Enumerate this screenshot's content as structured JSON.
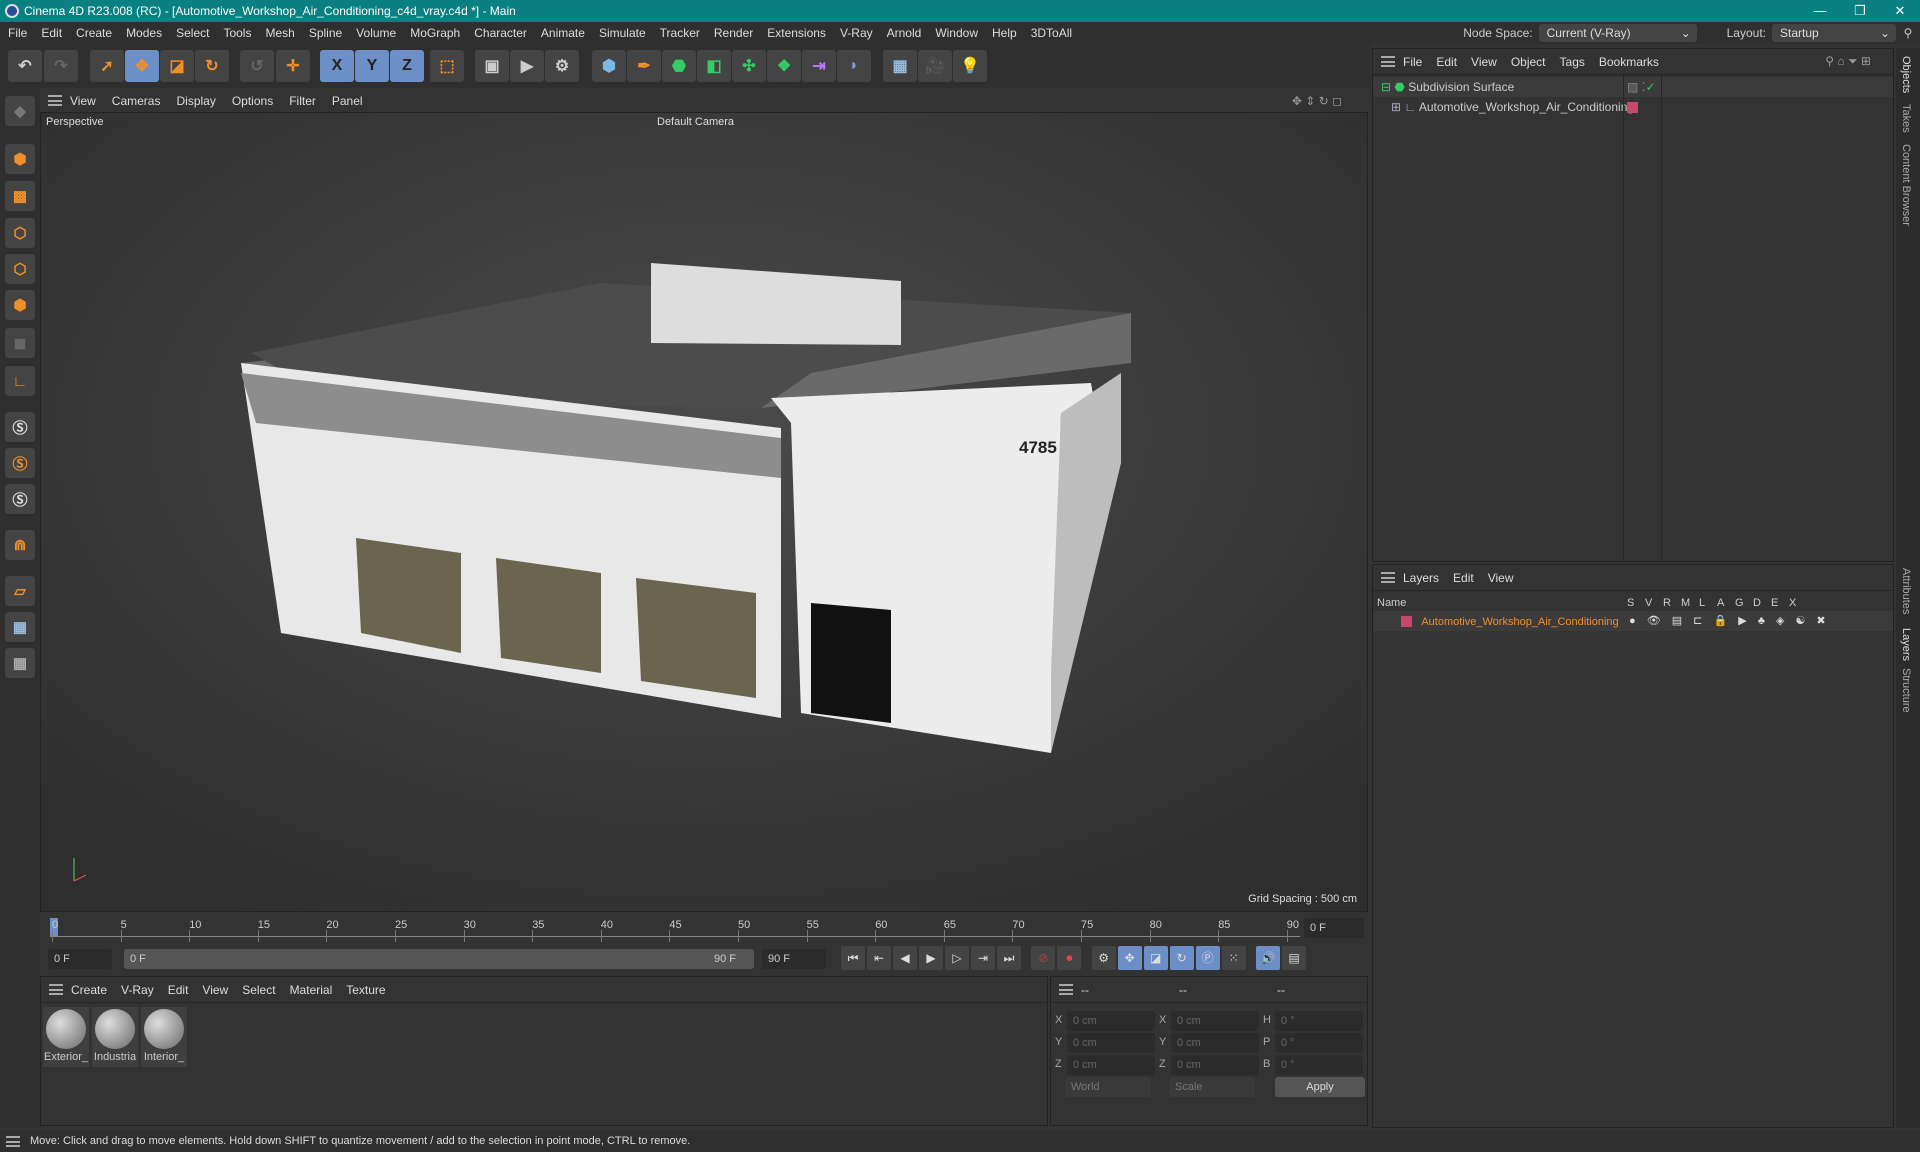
{
  "window": {
    "title": "Cinema 4D R23.008 (RC) - [Automotive_Workshop_Air_Conditioning_c4d_vray.c4d *] - Main",
    "minimize": "—",
    "restore": "❐",
    "close": "✕"
  },
  "menu": [
    "File",
    "Edit",
    "Create",
    "Modes",
    "Select",
    "Tools",
    "Mesh",
    "Spline",
    "Volume",
    "MoGraph",
    "Character",
    "Animate",
    "Simulate",
    "Tracker",
    "Render",
    "Extensions",
    "V-Ray",
    "Arnold",
    "Window",
    "Help",
    "3DToAll"
  ],
  "header": {
    "node_space_label": "Node Space:",
    "node_space_value": "Current (V-Ray)",
    "layout_label": "Layout:",
    "layout_value": "Startup"
  },
  "toolbar": {
    "x": "X",
    "y": "Y",
    "z": "Z"
  },
  "viewport": {
    "menu": [
      "View",
      "Cameras",
      "Display",
      "Options",
      "Filter",
      "Panel"
    ],
    "projection": "Perspective",
    "camera": "Default Camera",
    "grid_spacing": "Grid Spacing : 500 cm",
    "building_number": "4785"
  },
  "timeline": {
    "ticks": [
      "0",
      "5",
      "10",
      "15",
      "20",
      "25",
      "30",
      "35",
      "40",
      "45",
      "50",
      "55",
      "60",
      "65",
      "70",
      "75",
      "80",
      "85",
      "90"
    ],
    "current_frame": "0 F",
    "start": "0 F",
    "range_start": "0 F",
    "range_end": "90 F",
    "end": "90 F"
  },
  "materials": {
    "menu": [
      "Create",
      "V-Ray",
      "Edit",
      "View",
      "Select",
      "Material",
      "Texture"
    ],
    "items": [
      "Exterior_",
      "Industria",
      "Interior_"
    ]
  },
  "attributes": {
    "header": [
      "--",
      "--",
      "--"
    ],
    "rows": [
      {
        "a": "X",
        "av": "0 cm",
        "b": "X",
        "bv": "0 cm",
        "c": "H",
        "cv": "0 °"
      },
      {
        "a": "Y",
        "av": "0 cm",
        "b": "Y",
        "bv": "0 cm",
        "c": "P",
        "cv": "0 °"
      },
      {
        "a": "Z",
        "av": "0 cm",
        "b": "Z",
        "bv": "0 cm",
        "c": "B",
        "cv": "0 °"
      }
    ],
    "coord": "World",
    "mode": "Scale",
    "apply": "Apply"
  },
  "objects": {
    "menu": [
      "File",
      "Edit",
      "View",
      "Object",
      "Tags",
      "Bookmarks"
    ],
    "items": [
      "Subdivision Surface",
      "Automotive_Workshop_Air_Conditioning"
    ]
  },
  "layers": {
    "menu": [
      "Layers",
      "Edit",
      "View"
    ],
    "columns": [
      "Name",
      "S",
      "V",
      "R",
      "M",
      "L",
      "A",
      "G",
      "D",
      "E",
      "X"
    ],
    "item": "Automotive_Workshop_Air_Conditioning",
    "color": "#c8486a",
    "text_color": "#f0902a"
  },
  "right_tabs": [
    "Objects",
    "Takes",
    "Content Browser",
    "Attributes",
    "Layers",
    "Structure"
  ],
  "status": "Move: Click and drag to move elements. Hold down SHIFT to quantize movement / add to the selection in point mode, CTRL to remove.",
  "colors": {
    "titlebar": "#0b8082",
    "accent": "#f0902a",
    "selected": "#6c8fc7"
  }
}
